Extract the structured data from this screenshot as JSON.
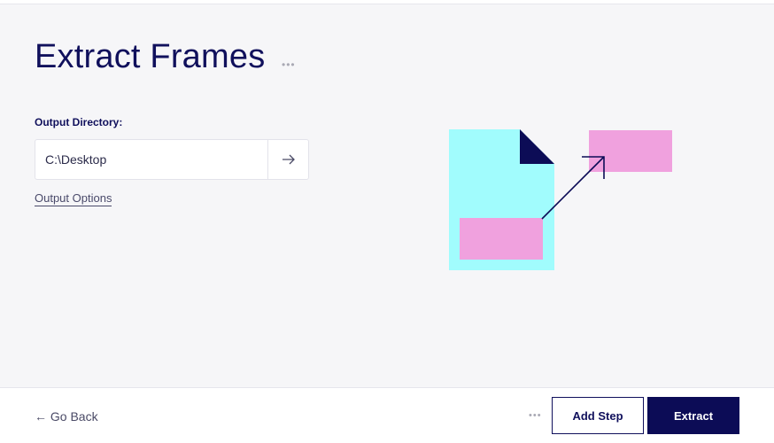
{
  "header": {
    "title": "Extract Frames",
    "more_dots": "•••"
  },
  "form": {
    "output_directory_label": "Output Directory:",
    "output_directory_value": "C:\\Desktop",
    "output_options_link": "Output Options"
  },
  "icons": {
    "browse": "arrow-right-icon",
    "back": "arrow-left-icon",
    "title_more": "ellipsis-icon",
    "footer_more": "ellipsis-icon"
  },
  "footer": {
    "go_back_label": "← Go Back",
    "more_dots": "•••",
    "add_step_label": "Add Step",
    "extract_label": "Extract"
  },
  "colors": {
    "primary": "#0c0c56",
    "document": "#a1fcfd",
    "frame": "#f0a1de",
    "background": "#f6f6f8"
  }
}
